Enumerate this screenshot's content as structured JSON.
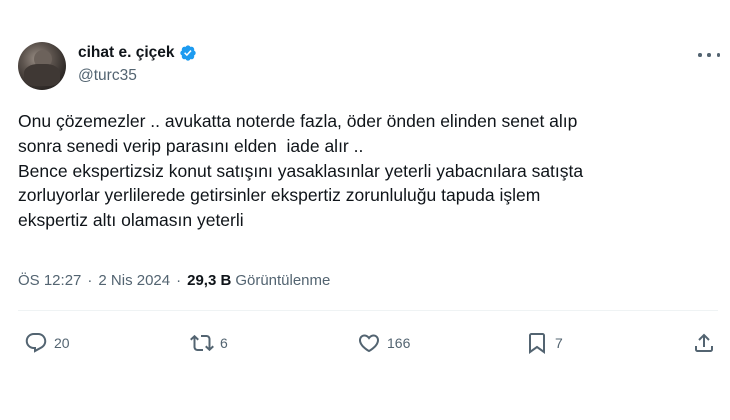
{
  "author": {
    "display_name": "cihat e. çiçek",
    "handle": "@turc35",
    "verified_color": "#1d9bf0"
  },
  "tweet": {
    "text": "Onu çözemezler .. avukatta noterde fazla, öder önden elinden senet alıp\nsonra senedi verip parasını elden  iade alır ..\nBence ekspertizsiz konut satışını yasaklasınlar yeterli yabacnılara satışta\nzorluyorlar yerlilerede getirsinler ekspertiz zorunluluğu tapuda işlem\nekspertiz altı olamasın yeterli"
  },
  "meta": {
    "time": "ÖS 12:27",
    "date": "2 Nis 2024",
    "separator": "·",
    "views_count": "29,3 B",
    "views_label": "Görüntülenme"
  },
  "actions": {
    "replies": "20",
    "reposts": "6",
    "likes": "166",
    "bookmarks": "7"
  },
  "icons": {
    "reply": "reply-icon",
    "repost": "repost-icon",
    "like": "heart-icon",
    "bookmark": "bookmark-icon",
    "share": "share-icon",
    "more": "more-icon",
    "verified": "verified-badge-icon"
  }
}
